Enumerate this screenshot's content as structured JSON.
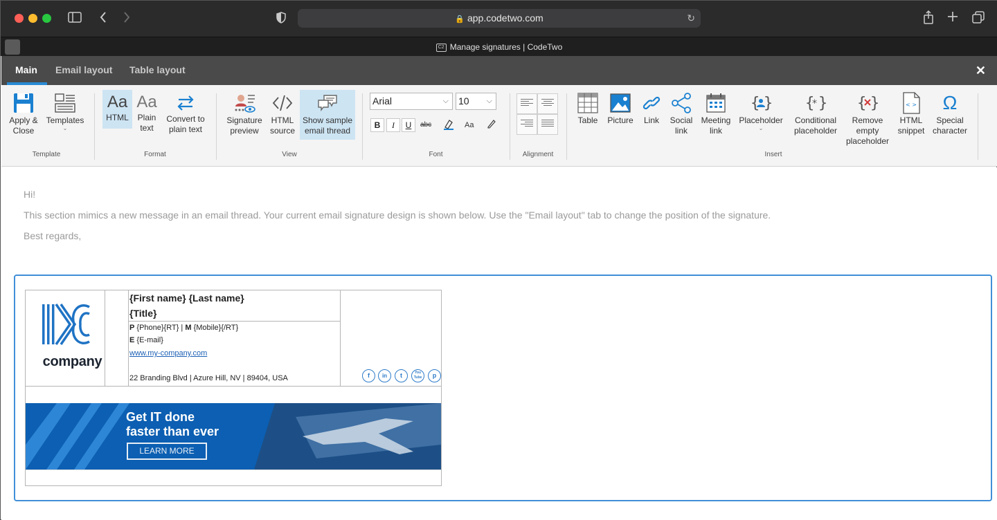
{
  "browser": {
    "url": "app.codetwo.com",
    "tab_title": "Manage signatures | CodeTwo",
    "favicon_text": "C2"
  },
  "app_tabs": [
    {
      "label": "Main",
      "active": true
    },
    {
      "label": "Email layout",
      "active": false
    },
    {
      "label": "Table layout",
      "active": false
    }
  ],
  "ribbon": {
    "template": {
      "label": "Template",
      "apply_close": "Apply &\nClose",
      "templates": "Templates"
    },
    "format": {
      "label": "Format",
      "html": "HTML",
      "plain_text": "Plain\ntext",
      "convert": "Convert to\nplain text",
      "icon_text": "Aa"
    },
    "view": {
      "label": "View",
      "signature_preview": "Signature\npreview",
      "html_source": "HTML\nsource",
      "show_sample": "Show sample\nemail thread"
    },
    "font": {
      "label": "Font",
      "family": "Arial",
      "size": "10",
      "bold": "B",
      "italic": "I",
      "underline": "U",
      "strike": "abc",
      "case": "Aa"
    },
    "alignment": {
      "label": "Alignment"
    },
    "insert": {
      "label": "Insert",
      "table": "Table",
      "picture": "Picture",
      "link": "Link",
      "social_link": "Social\nlink",
      "meeting_link": "Meeting\nlink",
      "placeholder": "Placeholder",
      "conditional_placeholder": "Conditional\nplaceholder",
      "remove_empty_placeholder": "Remove\nempty\nplaceholder",
      "html_snippet": "HTML\nsnippet",
      "special_character": "Special\ncharacter"
    }
  },
  "message": {
    "greeting": "Hi!",
    "body": "This section mimics a new message in an email thread. Your current email signature design is shown below. Use the \"Email layout\" tab to change the position of the signature.",
    "closing": "Best regards,"
  },
  "signature": {
    "logo_text": "company",
    "name": "{First name} {Last name}",
    "title": "{Title}",
    "phone_label": "P",
    "phone_value": "{Phone}{RT} | ",
    "mobile_label": "M",
    "mobile_value": "{Mobile}{/RT}",
    "email_label": "E",
    "email_value": "{E-mail}",
    "website": "www.my-company.com",
    "address": "22 Branding Blvd | Azure Hill, NV | 89404, USA",
    "social": [
      "f",
      "in",
      "t",
      "You\nTube",
      "p"
    ]
  },
  "banner": {
    "headline_line1": "Get IT done",
    "headline_line2": "faster than ever",
    "cta": "LEARN MORE"
  },
  "colors": {
    "accent": "#2a8ad4",
    "selection": "#cde4f3",
    "brand_blue": "#0c5fb2",
    "frame_border": "#3f8fd8"
  }
}
